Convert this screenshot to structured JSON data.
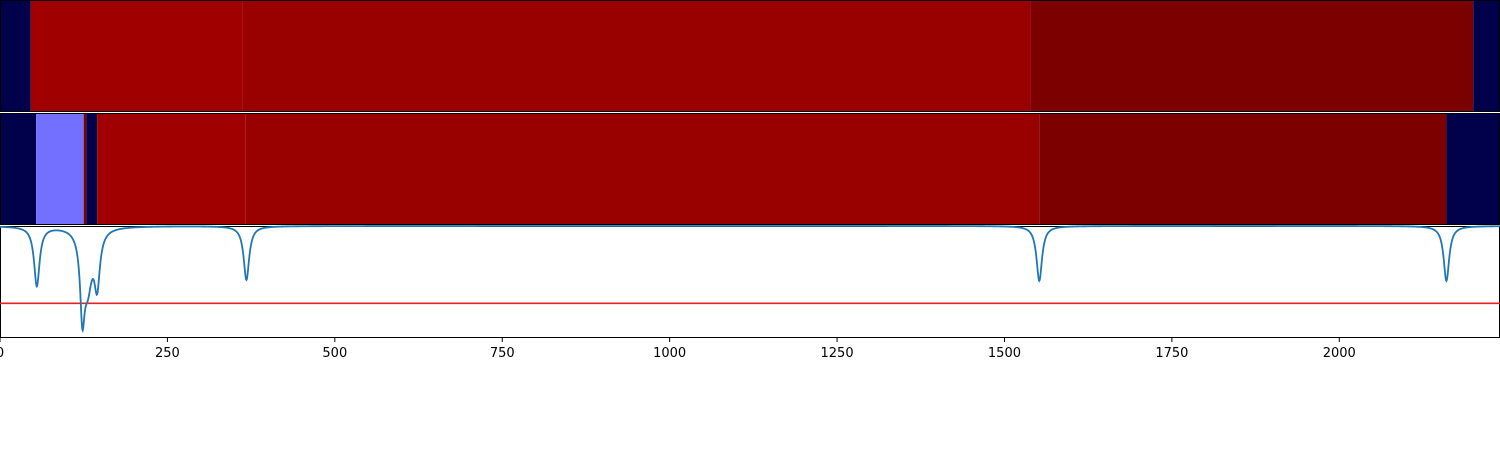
{
  "chart_data": {
    "type": "heatmap",
    "xlim": [
      0,
      2240
    ],
    "xticks": [
      0,
      250,
      500,
      750,
      1000,
      1250,
      1500,
      1750,
      2000
    ],
    "colors": {
      "background": "#00004b",
      "red_light": "#a00000",
      "red_mid": "#990000",
      "red_dark": "#7d0000",
      "blue_light": "#7370ff",
      "line": "#1f77b4",
      "threshold": "#e8201f"
    },
    "segments_top": [
      {
        "start": 0,
        "end": 46,
        "color": "background"
      },
      {
        "start": 46,
        "end": 362,
        "color": "red_light"
      },
      {
        "start": 362,
        "end": 1539,
        "color": "red_mid"
      },
      {
        "start": 1539,
        "end": 2200,
        "color": "red_dark"
      },
      {
        "start": 2200,
        "end": 2240,
        "color": "background"
      }
    ],
    "segments_bottom": [
      {
        "start": 0,
        "end": 54,
        "color": "background"
      },
      {
        "start": 54,
        "end": 125,
        "color": "blue_light"
      },
      {
        "start": 125,
        "end": 129,
        "color": "red_dark"
      },
      {
        "start": 129,
        "end": 145,
        "color": "background"
      },
      {
        "start": 145,
        "end": 367,
        "color": "red_light"
      },
      {
        "start": 367,
        "end": 1552,
        "color": "red_mid"
      },
      {
        "start": 1552,
        "end": 2160,
        "color": "red_dark"
      },
      {
        "start": 2160,
        "end": 2240,
        "color": "background"
      }
    ],
    "line_series": {
      "baseline": 1.0,
      "ylim": [
        0,
        1.0
      ],
      "threshold": 0.31,
      "dips": [
        {
          "x": 55,
          "depth": 0.53,
          "width": 5
        },
        {
          "x": 123,
          "depth": 0.66,
          "width": 4
        },
        {
          "x": 131,
          "depth": 0.48,
          "width": 8
        },
        {
          "x": 145,
          "depth": 0.47,
          "width": 5
        },
        {
          "x": 368,
          "depth": 0.48,
          "width": 5
        },
        {
          "x": 1552,
          "depth": 0.49,
          "width": 5
        },
        {
          "x": 2160,
          "depth": 0.49,
          "width": 5
        }
      ]
    }
  }
}
